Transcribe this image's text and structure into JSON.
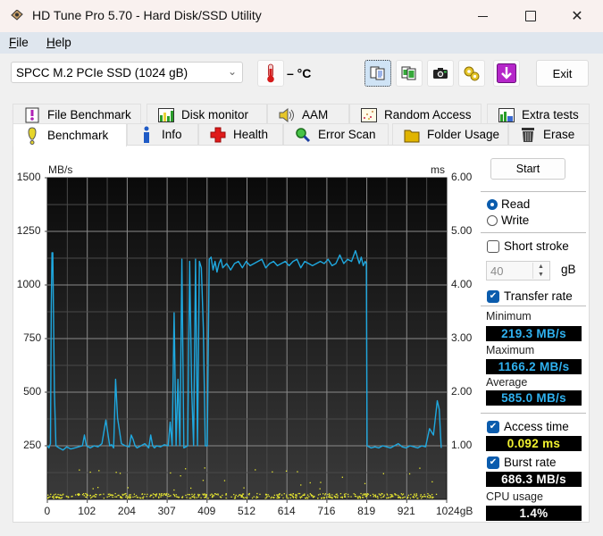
{
  "window": {
    "title": "HD Tune Pro 5.70 - Hard Disk/SSD Utility",
    "controls": {
      "minimize": "—",
      "maximize": "☐",
      "close": "✕"
    }
  },
  "menu": [
    {
      "label": "File",
      "accel": "F",
      "rest": "ile"
    },
    {
      "label": "Help",
      "accel": "H",
      "rest": "elp"
    }
  ],
  "toolbar": {
    "drive": "SPCC M.2 PCIe SSD (1024 gB)",
    "temperature": "– °C",
    "buttons": [
      "copy-info-icon",
      "copy-screenshot-icon",
      "camera-icon",
      "options-icon",
      "download-icon"
    ],
    "exit_label": "Exit"
  },
  "tabs": {
    "row1": [
      "File Benchmark",
      "Disk monitor",
      "AAM",
      "Random Access",
      "Extra tests"
    ],
    "row2": [
      "Benchmark",
      "Info",
      "Health",
      "Error Scan",
      "Folder Usage",
      "Erase"
    ],
    "active": "Benchmark"
  },
  "controls": {
    "start_label": "Start",
    "read_label": "Read",
    "write_label": "Write",
    "mode": "Read",
    "short_stroke_label": "Short stroke",
    "short_stroke_checked": false,
    "short_stroke_value": "40",
    "short_stroke_unit": "gB",
    "transfer_rate_label": "Transfer rate",
    "transfer_rate_checked": true,
    "minimum_label": "Minimum",
    "minimum_value": "219.3 MB/s",
    "maximum_label": "Maximum",
    "maximum_value": "1166.2 MB/s",
    "average_label": "Average",
    "average_value": "585.0 MB/s",
    "access_time_label": "Access time",
    "access_time_checked": true,
    "access_time_value": "0.092 ms",
    "burst_rate_label": "Burst rate",
    "burst_rate_checked": true,
    "burst_rate_value": "686.3 MB/s",
    "cpu_label": "CPU usage",
    "cpu_value": "1.4%"
  },
  "colors": {
    "transfer_line": "#1fa8df",
    "access_dots": "#e8e830",
    "stat_blue": "#2fb1ef",
    "stat_yellow": "#f2f230",
    "stat_white": "#ffffff"
  },
  "chart_data": {
    "type": "line",
    "ylabel_left": "MB/s",
    "ylabel_right": "ms",
    "ylim_left": [
      0,
      1500
    ],
    "ylim_right": [
      0,
      6
    ],
    "yticks_left": [
      "1500",
      "1250",
      "1000",
      "750",
      "500",
      "250"
    ],
    "yticks_right": [
      "6.00",
      "5.00",
      "4.00",
      "3.00",
      "2.00",
      "1.00"
    ],
    "xlim": [
      0,
      1024
    ],
    "xticks": [
      "0",
      "102",
      "204",
      "307",
      "409",
      "512",
      "614",
      "716",
      "819",
      "921",
      "1024gB"
    ],
    "grid": true,
    "series": [
      {
        "name": "Transfer rate (MB/s)",
        "x": [
          0,
          4,
          8,
          10,
          12,
          14,
          16,
          18,
          22,
          30,
          40,
          50,
          60,
          70,
          80,
          90,
          95,
          100,
          110,
          120,
          130,
          140,
          150,
          160,
          165,
          170,
          175,
          180,
          190,
          200,
          210,
          215,
          220,
          225,
          230,
          240,
          250,
          260,
          265,
          270,
          275,
          280,
          290,
          300,
          310,
          315,
          320,
          325,
          330,
          335,
          340,
          345,
          350,
          360,
          365,
          370,
          375,
          380,
          385,
          390,
          395,
          400,
          405,
          410,
          415,
          420,
          425,
          430,
          435,
          440,
          445,
          450,
          455,
          460,
          470,
          480,
          490,
          500,
          510,
          520,
          530,
          540,
          550,
          560,
          570,
          580,
          590,
          600,
          610,
          620,
          630,
          640,
          650,
          660,
          670,
          680,
          690,
          700,
          710,
          720,
          730,
          740,
          750,
          760,
          770,
          780,
          790,
          800,
          805,
          810,
          815,
          818,
          820,
          830,
          840,
          850,
          860,
          870,
          880,
          890,
          900,
          910,
          920,
          930,
          940,
          950,
          960,
          970,
          980,
          990,
          1000,
          1005,
          1010,
          1015,
          1020,
          1024
        ],
        "values": [
          250,
          240,
          260,
          900,
          1150,
          1150,
          820,
          500,
          250,
          240,
          230,
          245,
          235,
          240,
          245,
          250,
          300,
          250,
          240,
          250,
          245,
          260,
          370,
          250,
          255,
          240,
          560,
          380,
          260,
          250,
          245,
          300,
          280,
          250,
          240,
          250,
          260,
          240,
          300,
          250,
          240,
          250,
          245,
          255,
          250,
          360,
          250,
          870,
          250,
          560,
          250,
          1120,
          240,
          250,
          1110,
          520,
          250,
          1120,
          250,
          1110,
          1080,
          800,
          250,
          250,
          1120,
          1130,
          1070,
          1110,
          1060,
          1100,
          1120,
          1080,
          1090,
          1100,
          1070,
          1100,
          1110,
          1080,
          1110,
          1090,
          1100,
          1110,
          1120,
          1080,
          1100,
          1110,
          1090,
          1100,
          1110,
          1090,
          1110,
          1120,
          1080,
          1110,
          1100,
          1090,
          1100,
          1110,
          1100,
          1120,
          1090,
          1100,
          1140,
          1100,
          1120,
          1110,
          1160,
          1100,
          1130,
          1090,
          1110,
          1100,
          250,
          240,
          245,
          240,
          250,
          245,
          240,
          250,
          260,
          245,
          240,
          250,
          245,
          240,
          250,
          245,
          330,
          300,
          460,
          420,
          240
        ]
      },
      {
        "name": "Access time (ms)",
        "type": "scatter",
        "description": "dense yellow dots mostly between 0.05 and 0.15 ms across full range, scattered outliers up to ~0.6 ms"
      }
    ]
  }
}
